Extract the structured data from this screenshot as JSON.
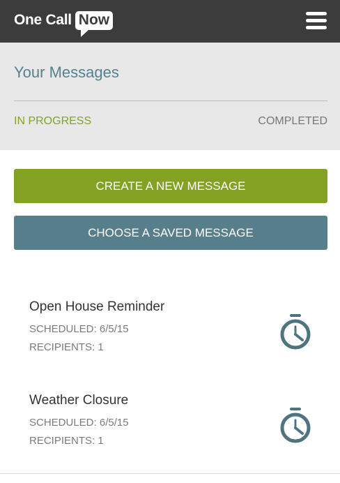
{
  "header": {
    "logo_text": "One Call",
    "logo_bubble": "Now",
    "menu_icon": "hamburger-menu-icon"
  },
  "page": {
    "title": "Your Messages"
  },
  "tabs": {
    "in_progress": "IN PROGRESS",
    "completed": "COMPLETED"
  },
  "actions": {
    "create": "CREATE A NEW MESSAGE",
    "choose": "CHOOSE A SAVED MESSAGE"
  },
  "messages": [
    {
      "title": "Open House Reminder",
      "scheduled": "SCHEDULED: 6/5/15",
      "recipients": "RECIPIENTS: 1",
      "icon": "stopwatch-icon"
    },
    {
      "title": "Weather Closure",
      "scheduled": "SCHEDULED: 6/5/15",
      "recipients": "RECIPIENTS: 1",
      "icon": "stopwatch-icon"
    }
  ],
  "colors": {
    "topbar": "#3c3c3c",
    "accent_green": "#83a122",
    "accent_teal": "#577e8b",
    "panel": "#e8e8e8"
  }
}
